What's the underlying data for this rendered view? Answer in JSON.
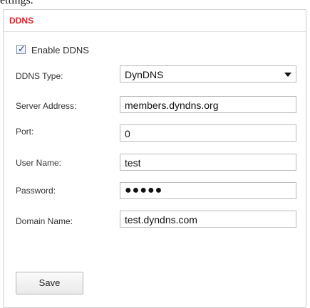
{
  "top_fragment": "ettings.",
  "panel": {
    "title": "DDNS",
    "enable": {
      "label": "Enable DDNS",
      "checked": true
    },
    "fields": {
      "type_label": "DDNS Type:",
      "type_value": "DynDNS",
      "server_label": "Server Address:",
      "server_value": "members.dyndns.org",
      "port_label": "Port:",
      "port_value": "0",
      "user_label": "User Name:",
      "user_value": "test",
      "password_label": "Password:",
      "password_value": "●●●●●",
      "domain_label": "Domain Name:",
      "domain_value": "test.dyndns.com"
    },
    "save_label": "Save"
  },
  "colors": {
    "title": "#d4272e",
    "checkbox_mark": "#2a3f9a"
  }
}
